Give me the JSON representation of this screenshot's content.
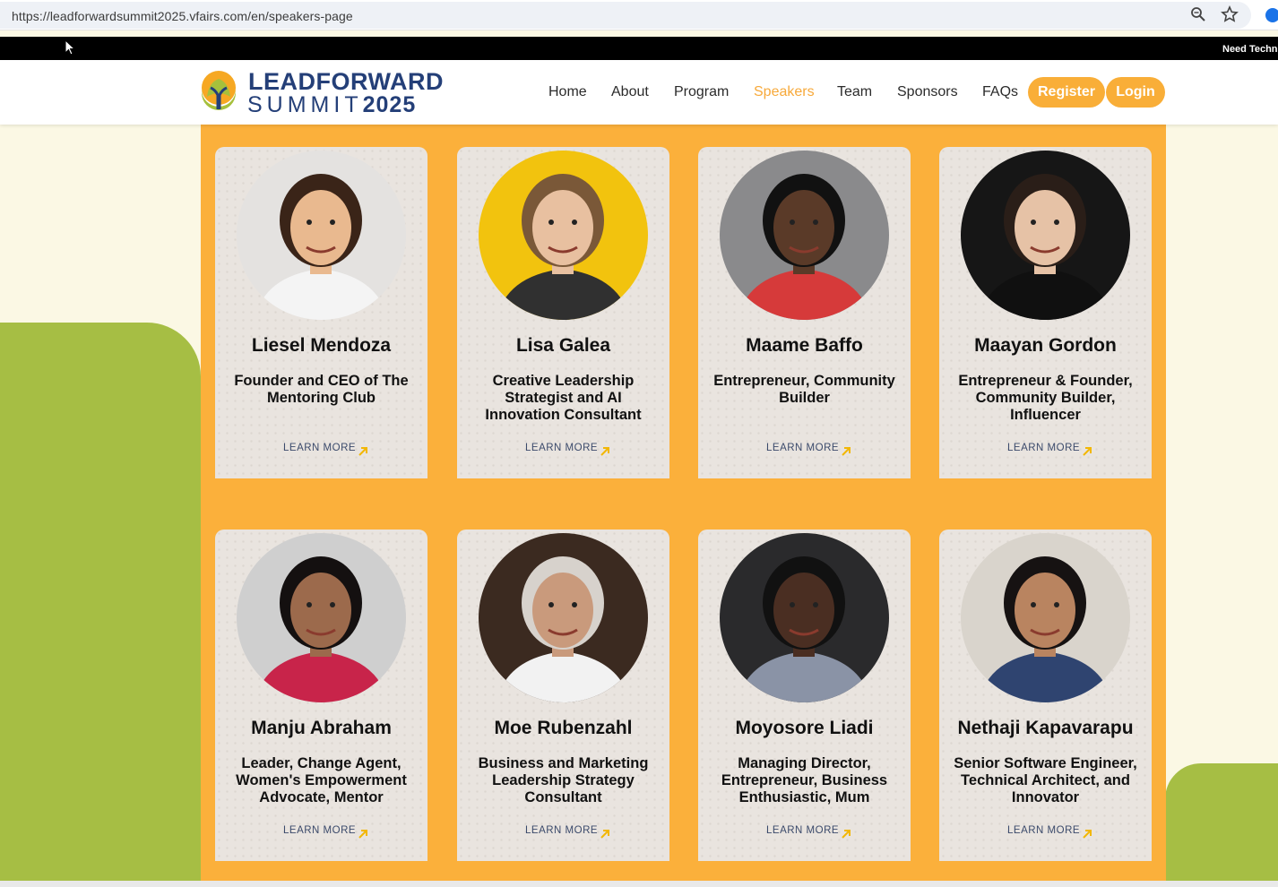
{
  "browser": {
    "url": "https://leadforwardsummit2025.vfairs.com/en/speakers-page"
  },
  "topstrip": {
    "text": "Need Techni"
  },
  "logo": {
    "line1": "LEADFORWARD",
    "line2a": "SUMMIT",
    "line2b": "2025"
  },
  "nav": {
    "items": [
      "Home",
      "About",
      "Program",
      "Speakers",
      "Team",
      "Sponsors",
      "FAQs"
    ],
    "active": "Speakers",
    "register": "Register",
    "login": "Login"
  },
  "colors": {
    "accent": "#fbb03b",
    "brand_navy": "#243f78",
    "green": "#a6be44",
    "card": "#e9e4df"
  },
  "speakers": [
    {
      "name": "Liesel Mendoza",
      "role": "Founder and CEO of The Mentoring Club",
      "link": "LEARN MORE",
      "photo_bg": "#e4e2e0"
    },
    {
      "name": "Lisa Galea",
      "role": "Creative Leadership Strategist and AI Innovation Consultant",
      "link": "LEARN MORE",
      "photo_bg": "#f2c30e"
    },
    {
      "name": "Maame Baffo",
      "role": "Entrepreneur, Community Builder",
      "link": "LEARN MORE",
      "photo_bg": "#8a8a8c"
    },
    {
      "name": "Maayan Gordon",
      "role": "Entrepreneur & Founder, Community Builder, Influencer",
      "link": "LEARN MORE",
      "photo_bg": "#161616"
    },
    {
      "name": "Manju Abraham",
      "role": "Leader, Change Agent, Women's Empowerment Advocate, Mentor",
      "link": "LEARN MORE",
      "photo_bg": "#cfcfcf"
    },
    {
      "name": "Moe Rubenzahl",
      "role": "Business and Marketing Leadership Strategy Consultant",
      "link": "LEARN MORE",
      "photo_bg": "#3b2a20"
    },
    {
      "name": "Moyosore Liadi",
      "role": "Managing Director, Entrepreneur, Business Enthusiastic, Mum",
      "link": "LEARN MORE",
      "photo_bg": "#2a2a2c"
    },
    {
      "name": "Nethaji Kapavarapu",
      "role": "Senior Software Engineer, Technical Architect, and Innovator",
      "link": "LEARN MORE",
      "photo_bg": "#d9d4cc"
    }
  ]
}
